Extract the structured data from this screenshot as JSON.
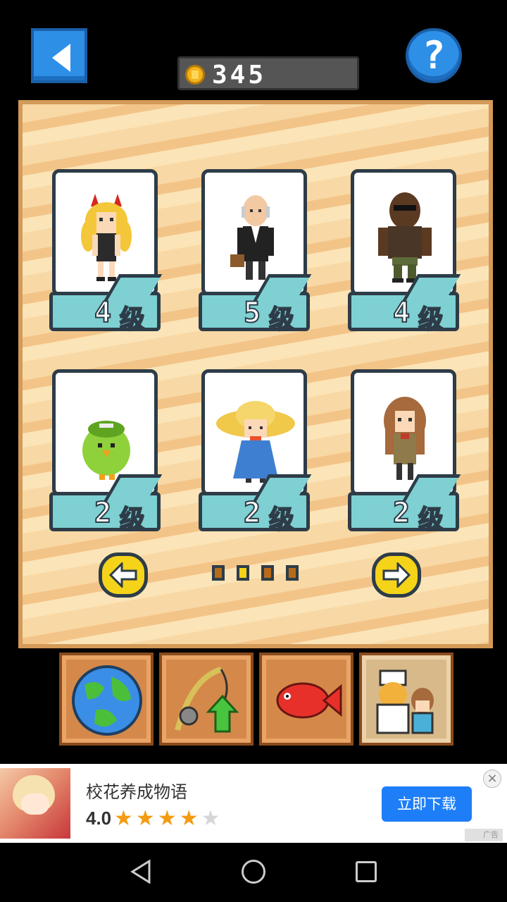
{
  "header": {
    "coins": "345",
    "help_label": "?"
  },
  "characters": [
    {
      "level": "4",
      "unit": "级",
      "name": "devil-girl"
    },
    {
      "level": "5",
      "unit": "级",
      "name": "old-man"
    },
    {
      "level": "4",
      "unit": "级",
      "name": "bearded-man"
    },
    {
      "level": "2",
      "unit": "级",
      "name": "green-bird"
    },
    {
      "level": "2",
      "unit": "级",
      "name": "straw-hat-girl"
    },
    {
      "level": "2",
      "unit": "级",
      "name": "brown-hair-girl"
    }
  ],
  "pagination": {
    "pages": 4,
    "current": 2
  },
  "tabs": [
    {
      "icon": "globe-icon",
      "active": false
    },
    {
      "icon": "fishing-rod-upgrade-icon",
      "active": false
    },
    {
      "icon": "fish-icon",
      "active": false
    },
    {
      "icon": "staff-icon",
      "active": true
    }
  ],
  "ad": {
    "title": "校花养成物语",
    "rating": "4.0",
    "stars_filled": 4,
    "stars_total": 5,
    "cta": "立即下载",
    "close": "×",
    "tag": "广告"
  },
  "colors": {
    "blue_button": "#2e8fe6",
    "board": "#f8d8a4",
    "plate": "#7ed0d2",
    "arrow": "#f5d319",
    "ad_button": "#1e7ef7"
  }
}
